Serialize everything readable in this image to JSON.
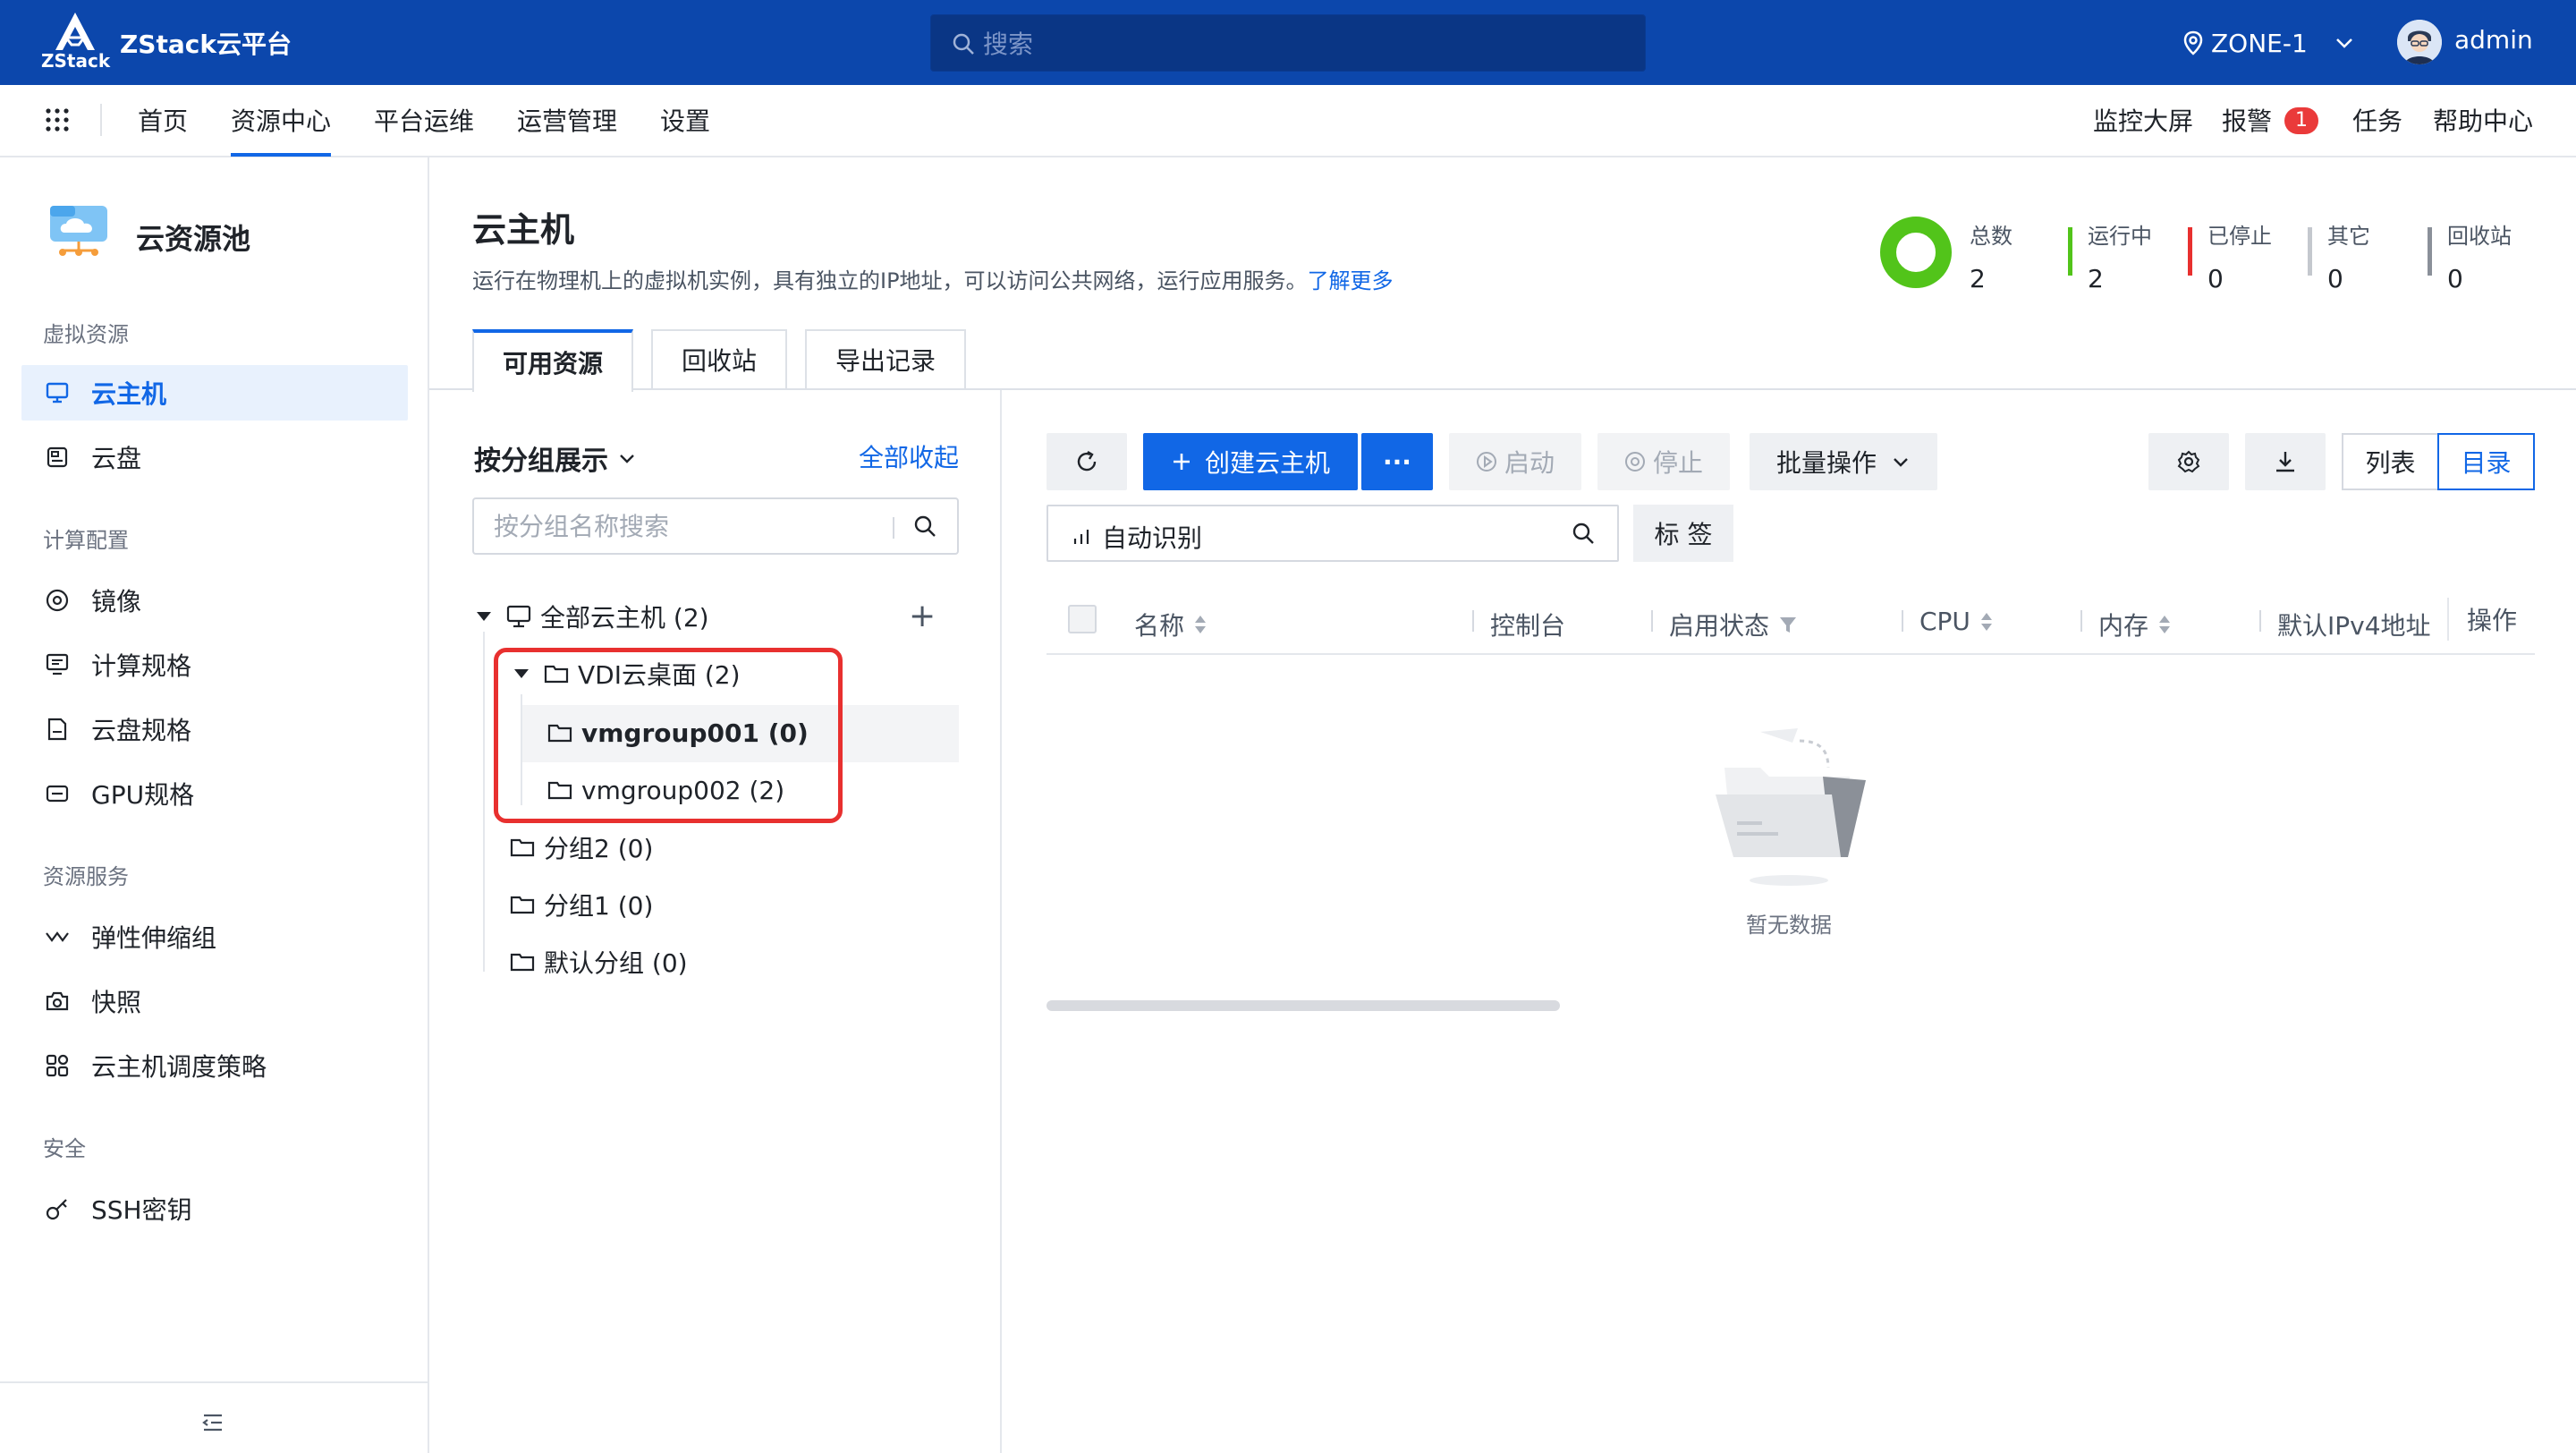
{
  "topbar": {
    "logo_text": "ZStack",
    "app_title": "ZStack云平台",
    "search_placeholder": "搜索",
    "zone": "ZONE-1",
    "username": "admin"
  },
  "nav": {
    "items": [
      "首页",
      "资源中心",
      "平台运维",
      "运营管理",
      "设置"
    ],
    "active": "资源中心",
    "right": {
      "monitor": "监控大屏",
      "alarm": "报警",
      "alarm_count": "1",
      "tasks": "任务",
      "help": "帮助中心"
    }
  },
  "sidebar": {
    "title": "云资源池",
    "groups": [
      {
        "label": "虚拟资源",
        "items": [
          {
            "label": "云主机",
            "icon": "monitor-icon",
            "active": true
          },
          {
            "label": "云盘",
            "icon": "disk-icon"
          }
        ]
      },
      {
        "label": "计算配置",
        "items": [
          {
            "label": "镜像",
            "icon": "image-disc-icon"
          },
          {
            "label": "计算规格",
            "icon": "compute-spec-icon"
          },
          {
            "label": "云盘规格",
            "icon": "disk-spec-icon"
          },
          {
            "label": "GPU规格",
            "icon": "gpu-spec-icon"
          }
        ]
      },
      {
        "label": "资源服务",
        "items": [
          {
            "label": "弹性伸缩组",
            "icon": "autoscale-icon"
          },
          {
            "label": "快照",
            "icon": "camera-icon"
          },
          {
            "label": "云主机调度策略",
            "icon": "scheduling-icon"
          }
        ]
      },
      {
        "label": "安全",
        "items": [
          {
            "label": "SSH密钥",
            "icon": "key-icon"
          }
        ]
      }
    ]
  },
  "header": {
    "title": "云主机",
    "description": "运行在物理机上的虚拟机实例，具有独立的IP地址，可以访问公共网络，运行应用服务。",
    "learn_more": "了解更多",
    "stats": [
      {
        "label": "总数",
        "value": "2",
        "color": ""
      },
      {
        "label": "运行中",
        "value": "2",
        "color": "#52c41a"
      },
      {
        "label": "已停止",
        "value": "0",
        "color": "#e8302f"
      },
      {
        "label": "其它",
        "value": "0",
        "color": "#c4c8ce"
      },
      {
        "label": "回收站",
        "value": "0",
        "color": "#8a9099"
      }
    ],
    "donut_color": "#52c41a"
  },
  "tabs": [
    "可用资源",
    "回收站",
    "导出记录"
  ],
  "groups_panel": {
    "title": "按分组展示",
    "collapse_all": "全部收起",
    "search_placeholder": "按分组名称搜索",
    "add_label": "+",
    "tree": [
      {
        "label": "全部云主机 (2)",
        "icon": "monitor-icon",
        "expanded": true
      },
      {
        "label": "VDI云桌面 (2)",
        "icon": "folder-icon",
        "expanded": true
      },
      {
        "label": "vmgroup001 (0)",
        "icon": "folder-icon",
        "bold": true
      },
      {
        "label": "vmgroup002 (2)",
        "icon": "folder-icon"
      },
      {
        "label": "分组2 (0)",
        "icon": "folder-icon"
      },
      {
        "label": "分组1 (0)",
        "icon": "folder-icon"
      },
      {
        "label": "默认分组 (0)",
        "icon": "folder-icon"
      }
    ]
  },
  "toolbar": {
    "create": "创建云主机",
    "more": "···",
    "start": "启动",
    "stop": "停止",
    "batch": "批量操作",
    "view_list": "列表",
    "view_dir": "目录",
    "auto_detect": "自动识别",
    "tag": "标 签"
  },
  "table": {
    "columns": [
      "名称",
      "控制台",
      "启用状态",
      "CPU",
      "内存",
      "默认IPv4地址",
      "操作"
    ],
    "empty_text": "暂无数据"
  },
  "colors": {
    "primary": "#1167e6",
    "topbar": "#0c47ac",
    "alarm": "#ea3a3a",
    "highlight_box": "#e8302f"
  }
}
